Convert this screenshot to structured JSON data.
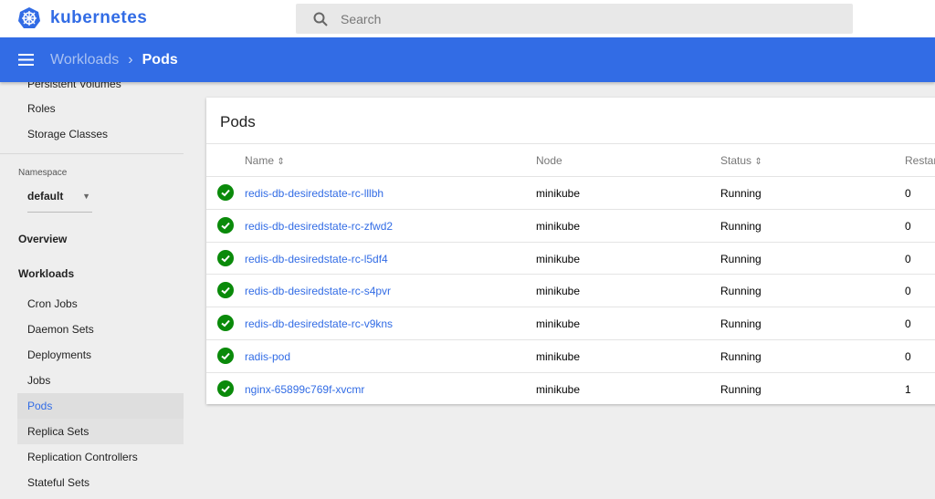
{
  "app": {
    "logo_text": "kubernetes",
    "brand_color": "#326ce5"
  },
  "search": {
    "placeholder": "Search"
  },
  "breadcrumb": {
    "parent": "Workloads",
    "current": "Pods"
  },
  "sidebar": {
    "items_top": [
      "Persistent Volumes",
      "Roles",
      "Storage Classes"
    ],
    "namespace_label": "Namespace",
    "namespace_value": "default",
    "overview": "Overview",
    "workloads": "Workloads",
    "workload_items": [
      "Cron Jobs",
      "Daemon Sets",
      "Deployments",
      "Jobs",
      "Pods",
      "Replica Sets",
      "Replication Controllers",
      "Stateful Sets"
    ],
    "active": "Pods"
  },
  "pods": {
    "title": "Pods",
    "columns": [
      "Name",
      "Node",
      "Status",
      "Restarts"
    ],
    "rows": [
      {
        "name": "redis-db-desiredstate-rc-lllbh",
        "node": "minikube",
        "status": "Running",
        "restarts": "0"
      },
      {
        "name": "redis-db-desiredstate-rc-zfwd2",
        "node": "minikube",
        "status": "Running",
        "restarts": "0"
      },
      {
        "name": "redis-db-desiredstate-rc-l5df4",
        "node": "minikube",
        "status": "Running",
        "restarts": "0"
      },
      {
        "name": "redis-db-desiredstate-rc-s4pvr",
        "node": "minikube",
        "status": "Running",
        "restarts": "0"
      },
      {
        "name": "redis-db-desiredstate-rc-v9kns",
        "node": "minikube",
        "status": "Running",
        "restarts": "0"
      },
      {
        "name": "radis-pod",
        "node": "minikube",
        "status": "Running",
        "restarts": "0"
      },
      {
        "name": "nginx-65899c769f-xvcmr",
        "node": "minikube",
        "status": "Running",
        "restarts": "1"
      }
    ]
  }
}
